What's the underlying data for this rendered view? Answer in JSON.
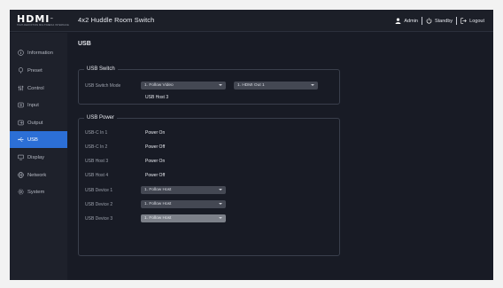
{
  "header": {
    "logo_text": "HDMI",
    "logo_tm": "™",
    "logo_tagline": "HIGH-DEFINITION MULTIMEDIA INTERFACE",
    "title": "4x2 Huddle Room Switch",
    "user_label": "Admin",
    "standby_label": "Standby",
    "logout_label": "Logout"
  },
  "sidebar": {
    "items": [
      {
        "label": "Information",
        "icon": "info-icon"
      },
      {
        "label": "Preset",
        "icon": "pin-icon"
      },
      {
        "label": "Control",
        "icon": "sliders-icon"
      },
      {
        "label": "Input",
        "icon": "input-icon"
      },
      {
        "label": "Output",
        "icon": "output-icon"
      },
      {
        "label": "USB",
        "icon": "usb-icon",
        "active": true
      },
      {
        "label": "Display",
        "icon": "display-icon"
      },
      {
        "label": "Network",
        "icon": "globe-icon"
      },
      {
        "label": "System",
        "icon": "gear-icon"
      }
    ]
  },
  "main": {
    "title": "USB",
    "usb_switch": {
      "title": "USB Switch",
      "mode_label": "USB Switch Mode",
      "mode_value": "1. Follow Video",
      "output_value": "1. HDMI Out 1",
      "host_value": "USB Host 3"
    },
    "usb_power": {
      "title": "USB Power",
      "status_rows": [
        {
          "label": "USB-C In 1",
          "value": "Power On"
        },
        {
          "label": "USB-C In 2",
          "value": "Power Off"
        },
        {
          "label": "USB Host 3",
          "value": "Power On"
        },
        {
          "label": "USB Host 4",
          "value": "Power Off"
        }
      ],
      "device_rows": [
        {
          "label": "USB Device 1",
          "value": "1. Follow Host",
          "enabled": true
        },
        {
          "label": "USB Device 2",
          "value": "1. Follow Host",
          "enabled": true
        },
        {
          "label": "USB Device 3",
          "value": "1. Follow Host",
          "enabled": false
        }
      ]
    }
  },
  "colors": {
    "accent": "#2c6fd6",
    "background": "#181b25",
    "sidebar": "#1e212b",
    "select": "#444853",
    "select_disabled": "#7c8089"
  }
}
